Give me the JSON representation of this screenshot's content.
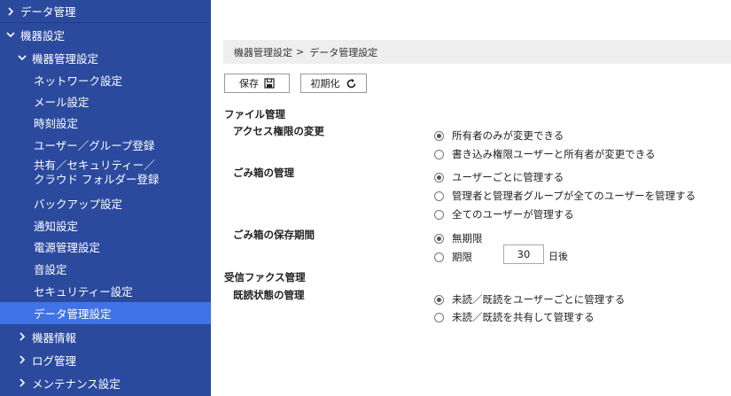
{
  "sidebar": {
    "top_item": "データ管理",
    "device_settings": "機器設定",
    "device_mgmt_settings": "機器管理設定",
    "leaves": [
      "ネットワーク設定",
      "メール設定",
      "時刻設定",
      "ユーザー／グループ登録",
      "共有／セキュリティー／",
      "クラウド フォルダー登録",
      "バックアップ設定",
      "通知設定",
      "電源管理設定",
      "音設定",
      "セキュリティー設定",
      "データ管理設定"
    ],
    "device_info": "機器情報",
    "log_mgmt": "ログ管理",
    "maintenance": "メンテナンス設定"
  },
  "breadcrumb": {
    "parent": "機器管理設定",
    "separator": ">",
    "current": "データ管理設定"
  },
  "toolbar": {
    "save_label": "保存",
    "init_label": "初期化"
  },
  "file_mgmt": {
    "title": "ファイル管理",
    "access": {
      "label": "アクセス権限の変更",
      "options": [
        "所有者のみが変更できる",
        "書き込み権限ユーザーと所有者が変更できる"
      ],
      "selected": 0
    },
    "trash": {
      "label": "ごみ箱の管理",
      "options": [
        "ユーザーごとに管理する",
        "管理者と管理者グループが全てのユーザーを管理する",
        "全てのユーザーが管理する"
      ],
      "selected": 0
    },
    "retention": {
      "label": "ごみ箱の保存期間",
      "options": [
        "無期限",
        "期限"
      ],
      "selected": 0,
      "days_value": "30",
      "days_unit": "日後"
    }
  },
  "fax": {
    "title": "受信ファクス管理",
    "read_status": {
      "label": "既読状態の管理",
      "options": [
        "未読／既読をユーザーごとに管理する",
        "未読／既読を共有して管理する"
      ],
      "selected": 0
    }
  },
  "colors": {
    "sidebar_bg": "#2b4a9e",
    "sidebar_active": "#3f73e6",
    "breadcrumb_bg": "#eeeeee"
  }
}
